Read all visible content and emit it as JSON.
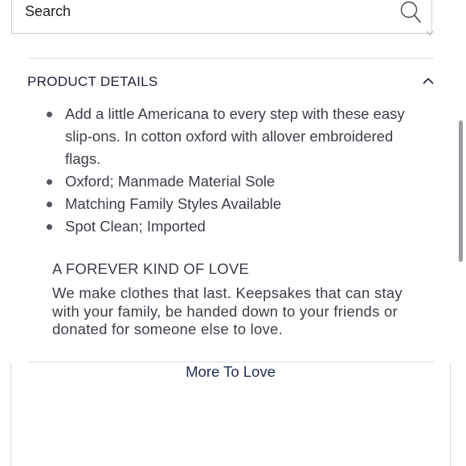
{
  "search": {
    "label": "Search",
    "icon": "search-icon"
  },
  "details": {
    "title": "PRODUCT DETAILS",
    "toggle_icon": "chevron-up-icon",
    "items": [
      {
        "text": "Add a little Americana to every step with these easy slip-ons. In cotton oxford with allover embroidered flags."
      },
      {
        "text": "Oxford; Manmade Material Sole"
      },
      {
        "text": "Matching Family Styles Available"
      },
      {
        "text": "Spot Clean; Imported"
      }
    ]
  },
  "forever": {
    "heading": "A FOREVER KIND OF LOVE",
    "body": "We make clothes that last. Keepsakes that can stay with your family, be handed down to your friends or donated for someone else to love."
  },
  "more_link": {
    "label": "More To Love"
  },
  "colors": {
    "link": "#1e2f52",
    "text": "#3d3d48",
    "divider": "#dcdce0"
  }
}
